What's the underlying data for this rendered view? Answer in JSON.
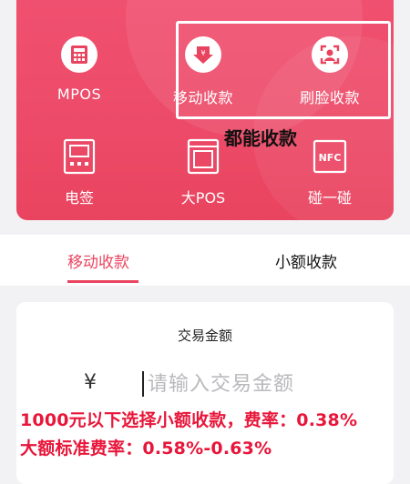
{
  "payment_methods": {
    "row1": [
      {
        "label": "MPOS",
        "icon": "calculator-icon"
      },
      {
        "label": "移动收款",
        "icon": "download-yen-icon"
      },
      {
        "label": "刷脸收款",
        "icon": "face-scan-icon"
      }
    ],
    "row2": [
      {
        "label": "电签",
        "icon": "terminal-icon"
      },
      {
        "label": "大POS",
        "icon": "pos-machine-icon"
      },
      {
        "label": "碰一碰",
        "icon": "nfc-icon",
        "icon_text": "NFC"
      }
    ]
  },
  "annotation_top": "都能收款",
  "tabs": [
    {
      "label": "移动收款",
      "active": true
    },
    {
      "label": "小额收款",
      "active": false
    }
  ],
  "transaction": {
    "title": "交易金额",
    "currency": "¥",
    "placeholder": "请输入交易金额"
  },
  "annotations": {
    "line1": "1000元以下选择小额收款，费率：0.38%",
    "line2": "大额标准费率：0.58%-0.63%"
  },
  "colors": {
    "panel": "#ec4a68",
    "accent": "#e9445f",
    "annotation_red": "#e8163a"
  }
}
